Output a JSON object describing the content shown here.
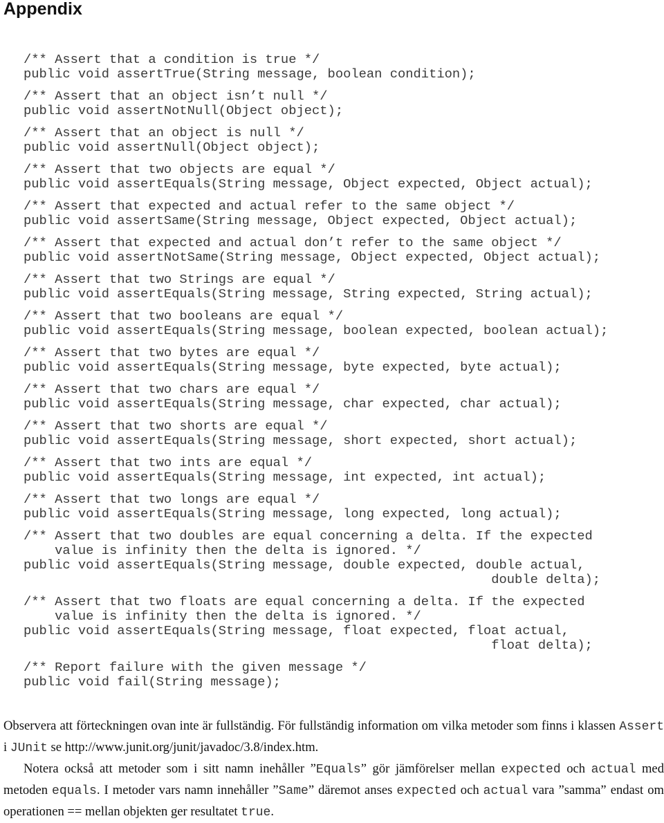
{
  "heading": "Appendix",
  "code_entries": [
    {
      "comment": [
        "/** Assert that a condition is true */"
      ],
      "signature": [
        "public void assertTrue(String message, boolean condition);"
      ]
    },
    {
      "comment": [
        "/** Assert that an object isn’t null */"
      ],
      "signature": [
        "public void assertNotNull(Object object);"
      ]
    },
    {
      "comment": [
        "/** Assert that an object is null */"
      ],
      "signature": [
        "public void assertNull(Object object);"
      ]
    },
    {
      "comment": [
        "/** Assert that two objects are equal */"
      ],
      "signature": [
        "public void assertEquals(String message, Object expected, Object actual);"
      ]
    },
    {
      "comment": [
        "/** Assert that expected and actual refer to the same object */"
      ],
      "signature": [
        "public void assertSame(String message, Object expected, Object actual);"
      ]
    },
    {
      "comment": [
        "/** Assert that expected and actual don’t refer to the same object */"
      ],
      "signature": [
        "public void assertNotSame(String message, Object expected, Object actual);"
      ]
    },
    {
      "comment": [
        "/** Assert that two Strings are equal */"
      ],
      "signature": [
        "public void assertEquals(String message, String expected, String actual);"
      ]
    },
    {
      "comment": [
        "/** Assert that two booleans are equal */"
      ],
      "signature": [
        "public void assertEquals(String message, boolean expected, boolean actual);"
      ]
    },
    {
      "comment": [
        "/** Assert that two bytes are equal */"
      ],
      "signature": [
        "public void assertEquals(String message, byte expected, byte actual);"
      ]
    },
    {
      "comment": [
        "/** Assert that two chars are equal */"
      ],
      "signature": [
        "public void assertEquals(String message, char expected, char actual);"
      ]
    },
    {
      "comment": [
        "/** Assert that two shorts are equal */"
      ],
      "signature": [
        "public void assertEquals(String message, short expected, short actual);"
      ]
    },
    {
      "comment": [
        "/** Assert that two ints are equal */"
      ],
      "signature": [
        "public void assertEquals(String message, int expected, int actual);"
      ]
    },
    {
      "comment": [
        "/** Assert that two longs are equal */"
      ],
      "signature": [
        "public void assertEquals(String message, long expected, long actual);"
      ]
    },
    {
      "comment": [
        "/** Assert that two doubles are equal concerning a delta. If the expected",
        "    value is infinity then the delta is ignored. */"
      ],
      "signature": [
        "public void assertEquals(String message, double expected, double actual,",
        "                                                            double delta);"
      ]
    },
    {
      "comment": [
        "/** Assert that two floats are equal concerning a delta. If the expected",
        "    value is infinity then the delta is ignored. */"
      ],
      "signature": [
        "public void assertEquals(String message, float expected, float actual,",
        "                                                            float delta);"
      ]
    },
    {
      "comment": [
        "/** Report failure with the given message */"
      ],
      "signature": [
        "public void fail(String message);"
      ]
    }
  ],
  "paragraphs": [
    {
      "indent": false,
      "segments": [
        {
          "type": "text",
          "value": "Observera att förteckningen ovan inte är fullständig. För fullständig information om vilka metoder som finns i klassen "
        },
        {
          "type": "code",
          "value": "Assert"
        },
        {
          "type": "text",
          "value": " i "
        },
        {
          "type": "code",
          "value": "JUnit"
        },
        {
          "type": "text",
          "value": " se http://www.junit.org/junit/javadoc/3.8/index.htm."
        }
      ]
    },
    {
      "indent": true,
      "segments": [
        {
          "type": "text",
          "value": "Notera också att metoder som i sitt namn inehåller ”"
        },
        {
          "type": "code",
          "value": "Equals"
        },
        {
          "type": "text",
          "value": "” gör jämförelser mellan "
        },
        {
          "type": "code",
          "value": "expected"
        },
        {
          "type": "text",
          "value": " och "
        },
        {
          "type": "code",
          "value": "actual"
        },
        {
          "type": "text",
          "value": " med metoden "
        },
        {
          "type": "code",
          "value": "equals"
        },
        {
          "type": "text",
          "value": ". I metoder vars namn innehåller ”"
        },
        {
          "type": "code",
          "value": "Same"
        },
        {
          "type": "text",
          "value": "” däremot anses "
        },
        {
          "type": "code",
          "value": "expected"
        },
        {
          "type": "text",
          "value": " och "
        },
        {
          "type": "code",
          "value": "actual"
        },
        {
          "type": "text",
          "value": " vara ”samma” endast om operationen == mellan objekten ger resultatet "
        },
        {
          "type": "code",
          "value": "true"
        },
        {
          "type": "text",
          "value": "."
        }
      ]
    }
  ]
}
